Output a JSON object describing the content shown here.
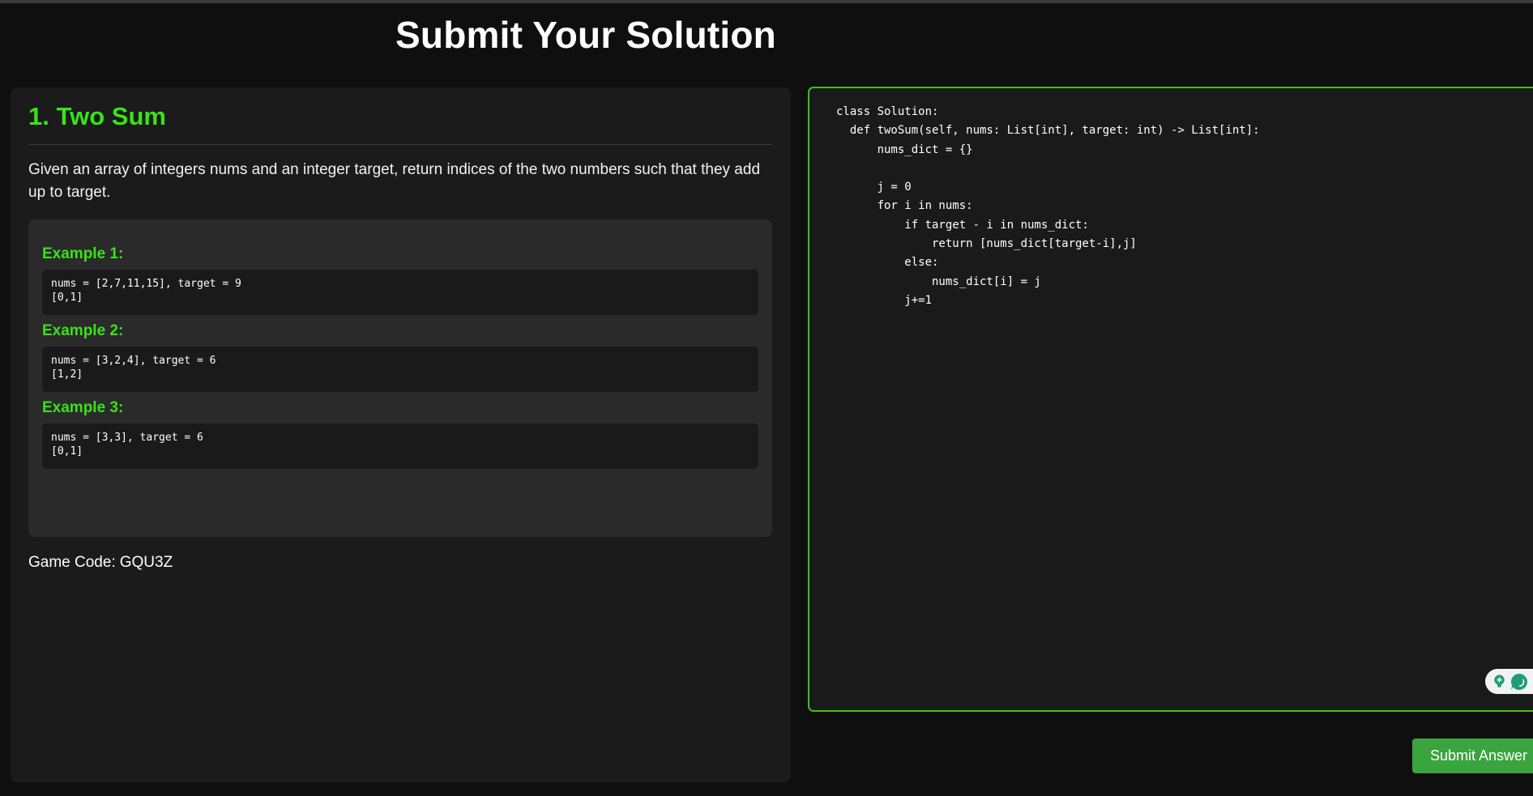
{
  "page": {
    "title": "Submit Your Solution"
  },
  "problem": {
    "title": "1. Two Sum",
    "description": "Given an array of integers nums and an integer target, return indices of the two numbers such that they add up to target.",
    "examples": [
      {
        "heading": "Example 1:",
        "code": "nums = [2,7,11,15], target = 9\n[0,1]"
      },
      {
        "heading": "Example 2:",
        "code": "nums = [3,2,4], target = 6\n[1,2]"
      },
      {
        "heading": "Example 3:",
        "code": "nums = [3,3], target = 6\n[0,1]"
      }
    ],
    "game_code_label": "Game Code:",
    "game_code_value": "GQU3Z"
  },
  "editor": {
    "code": "class Solution:\n  def twoSum(self, nums: List[int], target: int) -> List[int]:\n      nums_dict = {}\n\n      j = 0\n      for i in nums:\n          if target - i in nums_dict:\n              return [nums_dict[target-i],j]\n          else:\n              nums_dict[i] = j\n          j+=1"
  },
  "widget": {
    "icons": [
      "lightbulb-plus-icon",
      "chat-bubble-icon"
    ],
    "color": "#1f9c7a"
  },
  "actions": {
    "submit_label": "Submit Answer"
  },
  "colors": {
    "background": "#0f0f0f",
    "panel": "#1b1b1b",
    "accent_green": "#39e21a",
    "editor_border": "#39c21a",
    "submit_button": "#3aa43f"
  }
}
